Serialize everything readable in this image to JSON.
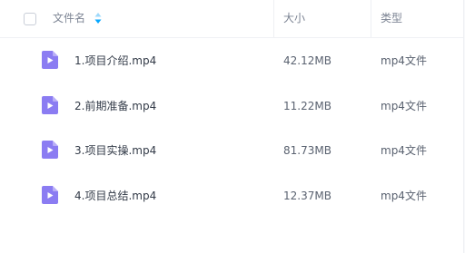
{
  "colors": {
    "accent": "#06a7ff",
    "video_icon": "#8b7cf2",
    "video_icon_fold": "#b9aef7"
  },
  "header": {
    "name_label": "文件名",
    "size_label": "大小",
    "type_label": "类型",
    "sort_icon": "sort-arrows-icon"
  },
  "files": [
    {
      "name": "1.项目介绍.mp4",
      "size": "42.12MB",
      "type": "mp4文件",
      "icon": "video-file-icon"
    },
    {
      "name": "2.前期准备.mp4",
      "size": "11.22MB",
      "type": "mp4文件",
      "icon": "video-file-icon"
    },
    {
      "name": "3.项目实操.mp4",
      "size": "81.73MB",
      "type": "mp4文件",
      "icon": "video-file-icon"
    },
    {
      "name": "4.项目总结.mp4",
      "size": "12.37MB",
      "type": "mp4文件",
      "icon": "video-file-icon"
    }
  ]
}
